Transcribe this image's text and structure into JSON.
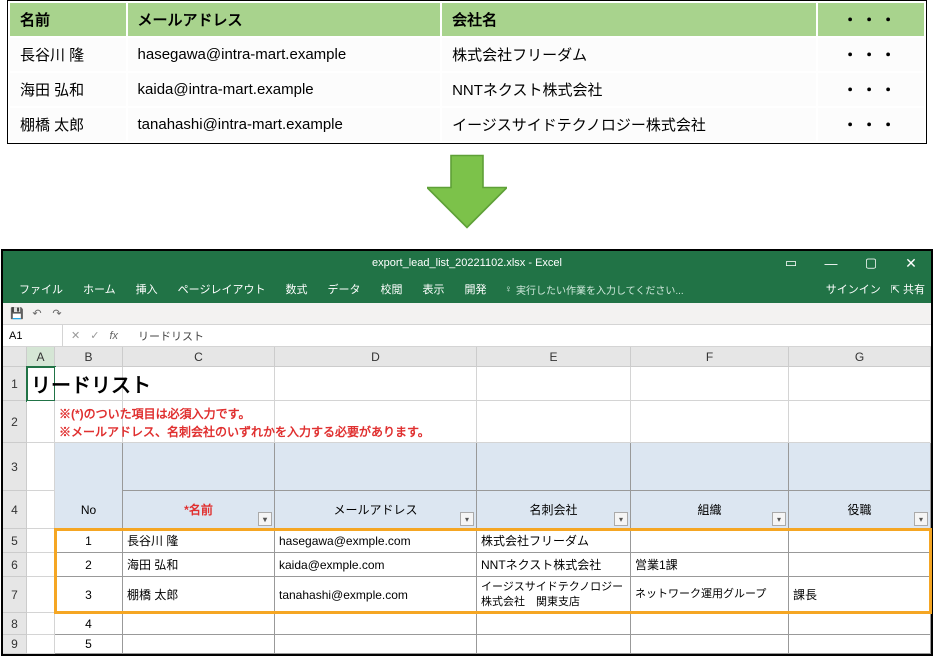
{
  "web_table": {
    "headers": [
      "名前",
      "メールアドレス",
      "会社名",
      "・・・"
    ],
    "rows": [
      {
        "name": "長谷川 隆",
        "email": "hasegawa@intra-mart.example",
        "company": "株式会社フリーダム",
        "more": "・・・"
      },
      {
        "name": "海田 弘和",
        "email": "kaida@intra-mart.example",
        "company": "NNTネクスト株式会社",
        "more": "・・・"
      },
      {
        "name": "棚橋 太郎",
        "email": "tanahashi@intra-mart.example",
        "company": "イージスサイドテクノロジー株式会社",
        "more": "・・・"
      }
    ]
  },
  "excel": {
    "title": "export_lead_list_20221102.xlsx - Excel",
    "tabs": [
      "ファイル",
      "ホーム",
      "挿入",
      "ページレイアウト",
      "数式",
      "データ",
      "校閲",
      "表示",
      "開発"
    ],
    "tell_me": "実行したい作業を入力してください...",
    "signin": "サインイン",
    "share": "共有",
    "name_box": "A1",
    "formula": "リードリスト",
    "cols": [
      "A",
      "B",
      "C",
      "D",
      "E",
      "F",
      "G"
    ],
    "row_nums": [
      "1",
      "2",
      "3",
      "4",
      "5",
      "6",
      "7",
      "8",
      "9"
    ],
    "sheet": {
      "title": "リードリスト",
      "note1": "※(*)のついた項目は必須入力です。",
      "note2": "※メールアドレス、名刺会社のいずれかを入力する必要があります。",
      "header_no": "No",
      "header_name": "*名前",
      "header_email": "メールアドレス",
      "header_company": "名刺会社",
      "header_org": "組織",
      "header_position": "役職",
      "rows": [
        {
          "no": "1",
          "name": "長谷川 隆",
          "email": "hasegawa@exmple.com",
          "company": "株式会社フリーダム",
          "org": "",
          "position": ""
        },
        {
          "no": "2",
          "name": "海田 弘和",
          "email": "kaida@exmple.com",
          "company": "NNTネクスト株式会社",
          "org": "営業1課",
          "position": ""
        },
        {
          "no": "3",
          "name": "棚橋 太郎",
          "email": "tanahashi@exmple.com",
          "company": "イージスサイドテクノロジー株式会社　関東支店",
          "org": "ネットワーク運用グループ",
          "position": "課長"
        },
        {
          "no": "4",
          "name": "",
          "email": "",
          "company": "",
          "org": "",
          "position": ""
        },
        {
          "no": "5",
          "name": "",
          "email": "",
          "company": "",
          "org": "",
          "position": ""
        }
      ]
    }
  }
}
